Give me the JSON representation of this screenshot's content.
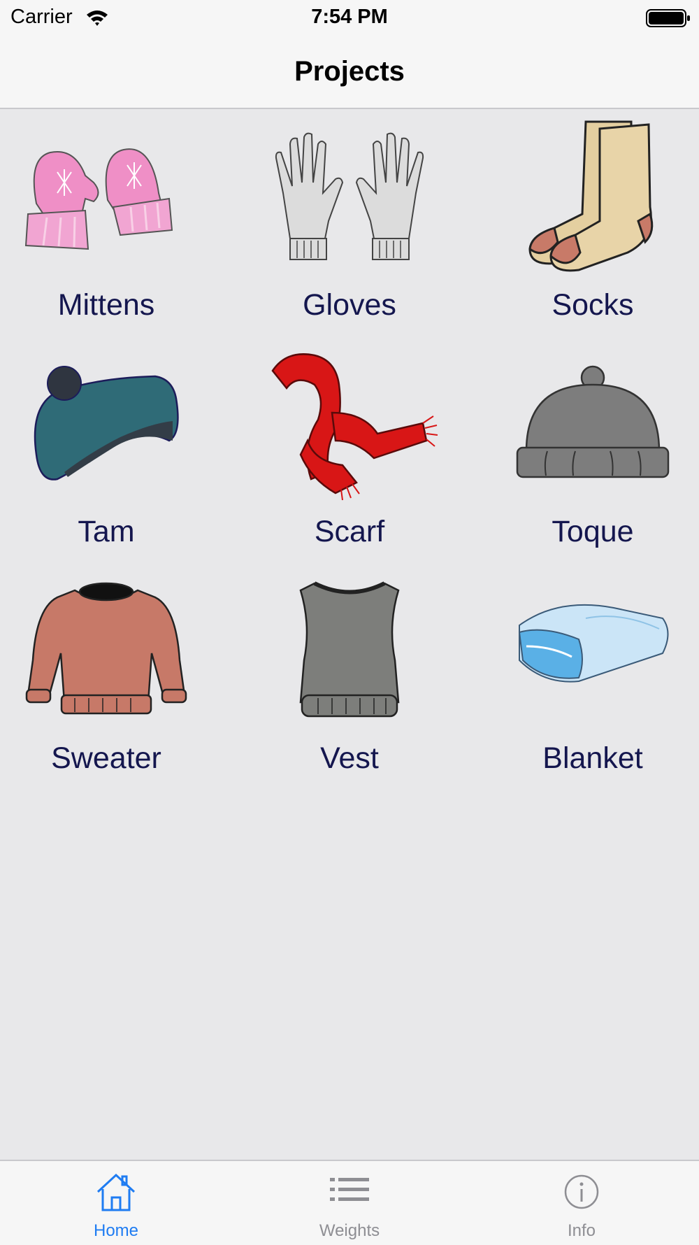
{
  "status_bar": {
    "carrier": "Carrier",
    "time": "7:54 PM"
  },
  "nav": {
    "title": "Projects"
  },
  "projects": [
    {
      "label": "Mittens",
      "icon": "mittens-icon"
    },
    {
      "label": "Gloves",
      "icon": "gloves-icon"
    },
    {
      "label": "Socks",
      "icon": "socks-icon"
    },
    {
      "label": "Tam",
      "icon": "tam-icon"
    },
    {
      "label": "Scarf",
      "icon": "scarf-icon"
    },
    {
      "label": "Toque",
      "icon": "toque-icon"
    },
    {
      "label": "Sweater",
      "icon": "sweater-icon"
    },
    {
      "label": "Vest",
      "icon": "vest-icon"
    },
    {
      "label": "Blanket",
      "icon": "blanket-icon"
    }
  ],
  "tabs": [
    {
      "label": "Home",
      "icon": "home-icon",
      "active": true
    },
    {
      "label": "Weights",
      "icon": "list-icon",
      "active": false
    },
    {
      "label": "Info",
      "icon": "info-icon",
      "active": false
    }
  ],
  "colors": {
    "accent": "#1f7cf2",
    "label_text": "#14164e",
    "background": "#e8e8ea"
  }
}
